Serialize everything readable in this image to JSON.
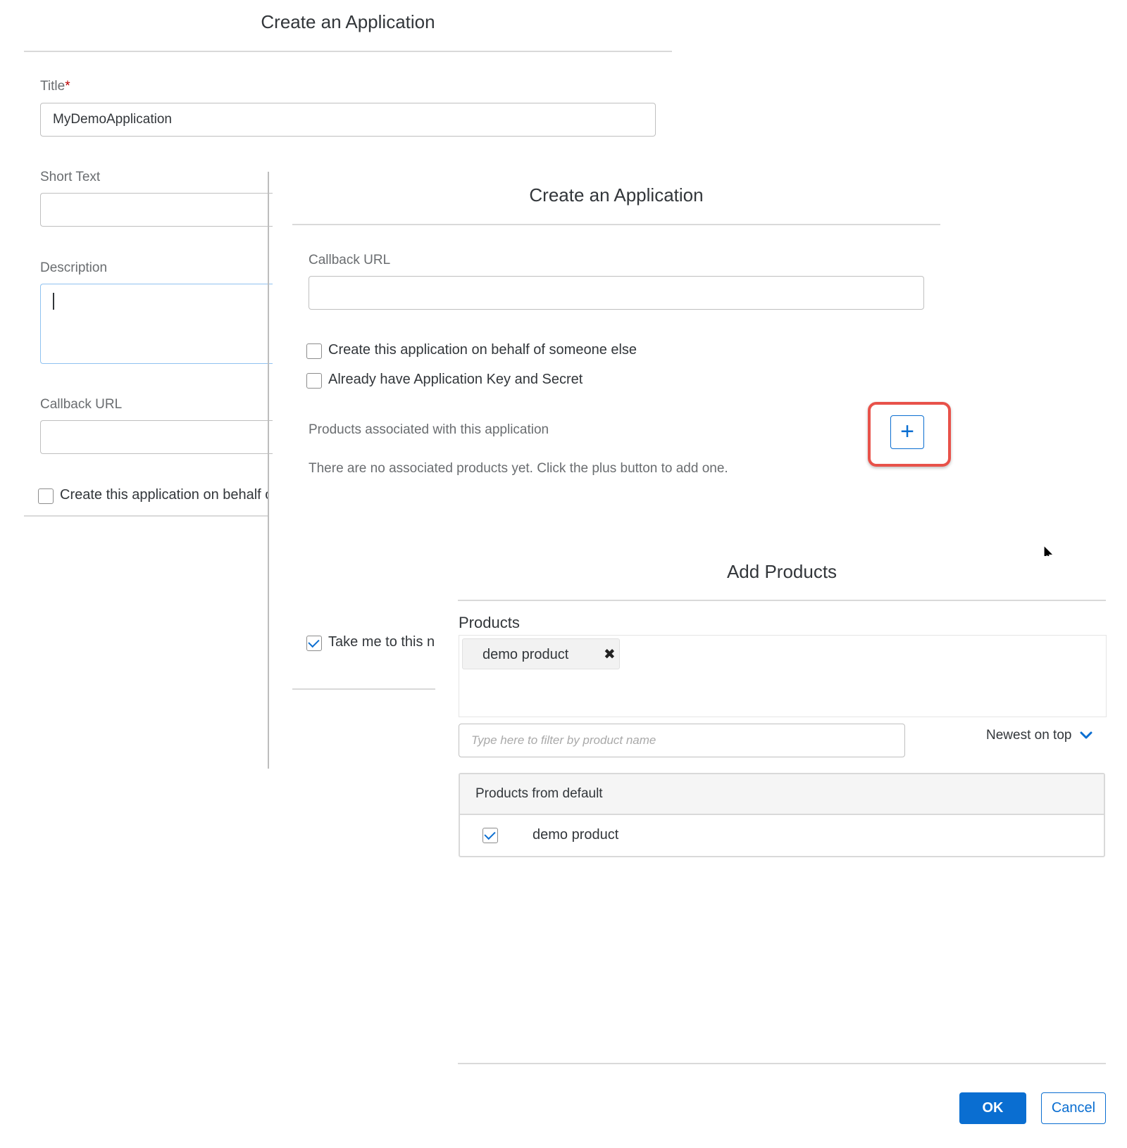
{
  "dialog_back": {
    "title": "Create an Application",
    "title_label": "Title",
    "required_marker": "*",
    "title_value": "MyDemoApplication",
    "short_text_label": "Short Text",
    "description_label": "Description",
    "callback_url_label": "Callback URL",
    "behalf_checkbox_label": "Create this application on behalf of someone else"
  },
  "dialog_mid": {
    "title": "Create an Application",
    "callback_url_label": "Callback URL",
    "behalf_checkbox_label": "Create this application on behalf of someone else",
    "key_secret_checkbox_label": "Already have Application Key and Secret",
    "products_label": "Products associated with this application",
    "no_products_text": "There are no associated products yet. Click the plus button to add one.",
    "add_button_symbol": "+",
    "take_me_checkbox_label": "Take me to this new application"
  },
  "add_products": {
    "title": "Add Products",
    "products_label": "Products",
    "selected_products": [
      {
        "name": "demo product",
        "remove_symbol": "✖"
      }
    ],
    "filter_placeholder": "Type here to filter by product name",
    "sort_label": "Newest on top",
    "group_header": "Products from default",
    "product_rows": [
      {
        "name": "demo product",
        "checked": true
      }
    ],
    "ok_label": "OK",
    "cancel_label": "Cancel"
  },
  "colors": {
    "primary": "#0a6ed1",
    "highlight": "#e8524a",
    "required": "#bb0000"
  }
}
